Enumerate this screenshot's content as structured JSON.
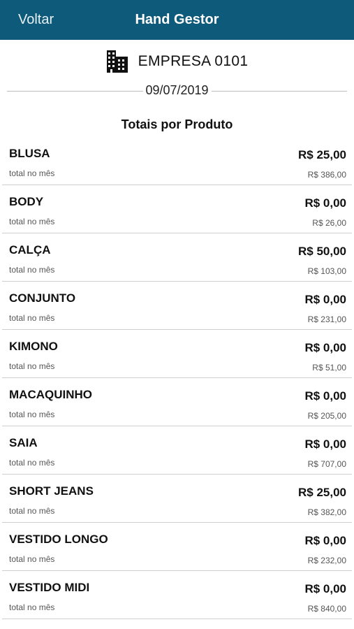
{
  "header": {
    "back_label": "Voltar",
    "title": "Hand Gestor",
    "background_color": "#0e5a7a"
  },
  "company": {
    "icon": "building-icon",
    "name": "EMPRESA 0101"
  },
  "date": "09/07/2019",
  "section_title": "Totais por Produto",
  "products": [
    {
      "name": "BLUSA",
      "value": "R$ 25,00",
      "sub_label": "total no mês",
      "month_total": "R$ 386,00"
    },
    {
      "name": "BODY",
      "value": "R$ 0,00",
      "sub_label": "total no mês",
      "month_total": "R$ 26,00"
    },
    {
      "name": "CALÇA",
      "value": "R$ 50,00",
      "sub_label": "total no mês",
      "month_total": "R$ 103,00"
    },
    {
      "name": "CONJUNTO",
      "value": "R$ 0,00",
      "sub_label": "total no mês",
      "month_total": "R$ 231,00"
    },
    {
      "name": "KIMONO",
      "value": "R$ 0,00",
      "sub_label": "total no mês",
      "month_total": "R$ 51,00"
    },
    {
      "name": "MACAQUINHO",
      "value": "R$ 0,00",
      "sub_label": "total no mês",
      "month_total": "R$ 205,00"
    },
    {
      "name": "SAIA",
      "value": "R$ 0,00",
      "sub_label": "total no mês",
      "month_total": "R$ 707,00"
    },
    {
      "name": "SHORT JEANS",
      "value": "R$ 25,00",
      "sub_label": "total no mês",
      "month_total": "R$ 382,00"
    },
    {
      "name": "VESTIDO LONGO",
      "value": "R$ 0,00",
      "sub_label": "total no mês",
      "month_total": "R$ 232,00"
    },
    {
      "name": "VESTIDO MIDI",
      "value": "R$ 0,00",
      "sub_label": "total no mês",
      "month_total": "R$ 840,00"
    }
  ]
}
